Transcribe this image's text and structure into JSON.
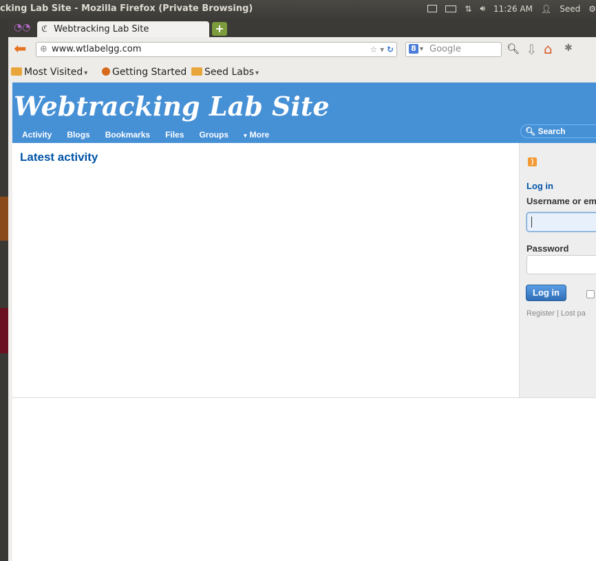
{
  "window": {
    "title": "cking Lab Site - Mozilla Firefox (Private Browsing)",
    "time": "11:26 AM",
    "user": "Seed"
  },
  "browser": {
    "tab_title": "Webtracking Lab Site",
    "url": "www.wtlabelgg.com",
    "search_placeholder": "Google",
    "bookmarks": [
      "Most Visited",
      "Getting Started",
      "Seed Labs"
    ]
  },
  "site": {
    "title": "Webtracking Lab Site",
    "nav": [
      "Activity",
      "Blogs",
      "Bookmarks",
      "Files",
      "Groups",
      "More"
    ],
    "search_label": "Search"
  },
  "main": {
    "heading": "Latest activity"
  },
  "login": {
    "heading": "Log in",
    "username_label": "Username or em",
    "password_label": "Password",
    "button": "Log in",
    "register": "Register",
    "lost_password": "Lost pa"
  },
  "colors": {
    "header_blue": "#4690d6",
    "link_blue": "#0054a7",
    "panel_dark": "#3c3b37"
  }
}
